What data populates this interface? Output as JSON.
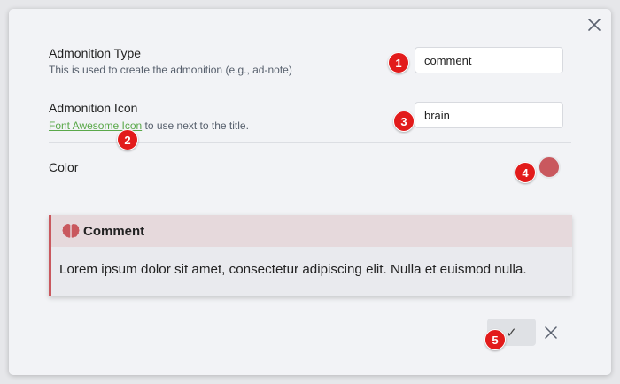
{
  "settings": [
    {
      "name": "Admonition Type",
      "desc": "This is used to create the admonition (e.g., ad-note)",
      "value": "comment"
    },
    {
      "name": "Admonition Icon",
      "desc_link": "Font Awesome Icon",
      "desc_rest": " to use next to the title.",
      "value": "brain"
    },
    {
      "name": "Color",
      "color_value": "#c9585e"
    }
  ],
  "preview": {
    "title": "Comment",
    "body": "Lorem ipsum dolor sit amet, consectetur adipiscing elit. Nulla et euismod nulla.",
    "icon": "brain-icon",
    "color": "#c9585e"
  },
  "buttons": {
    "ok_glyph": "✓",
    "ok_icon": "checkmark-icon",
    "cancel_icon": "close-icon",
    "close_icon": "close-icon"
  },
  "badges": [
    "1",
    "2",
    "3",
    "4",
    "5"
  ]
}
